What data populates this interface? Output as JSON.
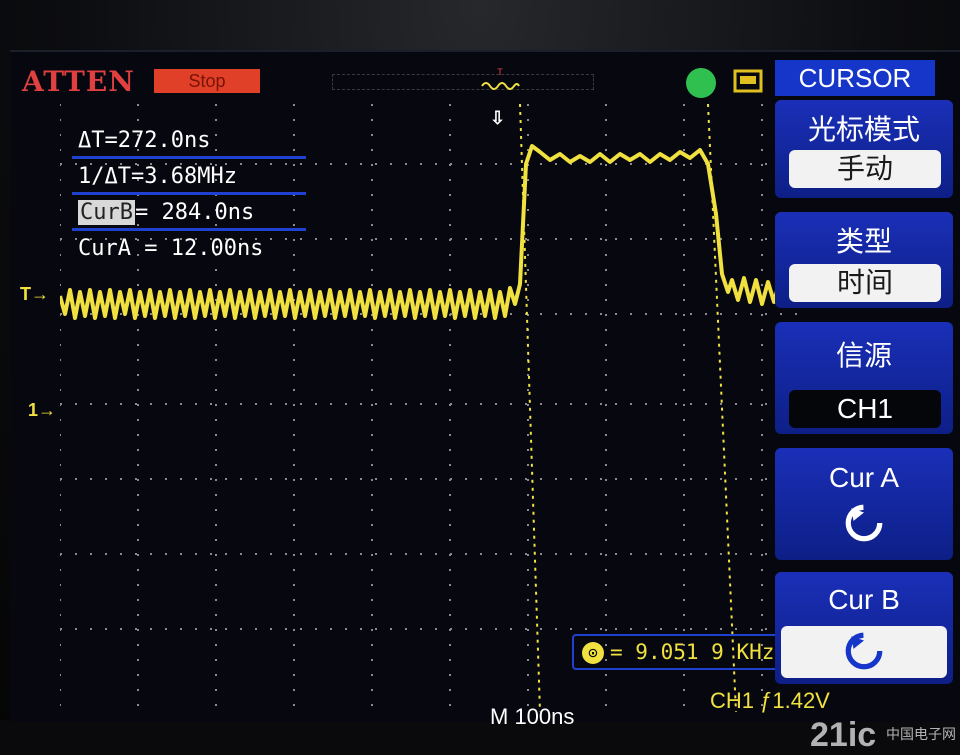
{
  "header": {
    "brand": "ATTEN",
    "run_status": "Stop"
  },
  "readouts": {
    "delta_t": "ΔT=272.0ns",
    "inv_delta_t": "1/ΔT=3.68MHz",
    "cur_b_tag": "CurB",
    "cur_b_value": "= 284.0ns",
    "cur_a": "CurA = 12.00ns"
  },
  "menu": {
    "title": "CURSOR",
    "mode_label": "光标模式",
    "mode_value": "手动",
    "type_label": "类型",
    "type_value": "时间",
    "source_label": "信源",
    "source_value": "CH1",
    "cur_a_label": "Cur A",
    "cur_b_label": "Cur B"
  },
  "status": {
    "frequency": "9.051 9 KHz",
    "timebase": "M 100ns",
    "channel": "CH1 ƒ1.42V"
  },
  "markers": {
    "trigger_level": "T",
    "channel_ground": "1"
  },
  "watermark": {
    "logo": "21ic",
    "site": "中国电子网"
  },
  "colors": {
    "trace": "#f0e040",
    "menu_blue": "#1536c8",
    "brand_red": "#e04040",
    "grid": "#9a9a9a"
  },
  "icons": {
    "trig_position": "trigger-position-icon",
    "trig_status": "trigger-status-icon",
    "usb": "usb-icon",
    "rotate": "rotate-knob-icon"
  }
}
